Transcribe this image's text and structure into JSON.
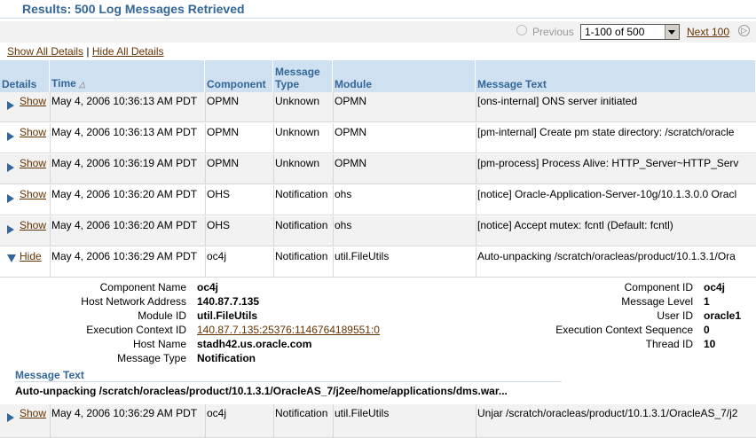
{
  "page": {
    "title": "Results: 500 Log Messages Retrieved"
  },
  "nav": {
    "previous": "Previous",
    "range": "1-100 of 500",
    "next": "Next 100"
  },
  "details_links": {
    "show_all": "Show All Details",
    "hide_all": "Hide All Details",
    "separator": "|"
  },
  "table": {
    "headers": {
      "details": "Details",
      "time": "Time",
      "component": "Component",
      "message_type_1": "Message",
      "message_type_2": "Type",
      "module": "Module",
      "message_text": "Message Text"
    },
    "rows": [
      {
        "action": "Show",
        "time": "May 4, 2006 10:36:13 AM PDT",
        "component": "OPMN",
        "type": "Unknown",
        "module": "OPMN",
        "text": "[ons-internal] ONS server initiated"
      },
      {
        "action": "Show",
        "time": "May 4, 2006 10:36:13 AM PDT",
        "component": "OPMN",
        "type": "Unknown",
        "module": "OPMN",
        "text": "[pm-internal] Create pm state directory: /scratch/oracle"
      },
      {
        "action": "Show",
        "time": "May 4, 2006 10:36:19 AM PDT",
        "component": "OPMN",
        "type": "Unknown",
        "module": "OPMN",
        "text": "[pm-process] Process Alive: HTTP_Server~HTTP_Serv"
      },
      {
        "action": "Show",
        "time": "May 4, 2006 10:36:20 AM PDT",
        "component": "OHS",
        "type": "Notification",
        "module": "ohs",
        "text": "[notice] Oracle-Application-Server-10g/10.1.3.0.0 Oracl"
      },
      {
        "action": "Show",
        "time": "May 4, 2006 10:36:20 AM PDT",
        "component": "OHS",
        "type": "Notification",
        "module": "ohs",
        "text": "[notice] Accept mutex: fcntl (Default: fcntl)"
      },
      {
        "action": "Hide",
        "time": "May 4, 2006 10:36:29 AM PDT",
        "component": "oc4j",
        "type": "Notification",
        "module": "util.FileUtils",
        "text": "Auto-unpacking /scratch/oracleas/product/10.1.3.1/Ora"
      },
      {
        "action": "Show",
        "time": "May 4, 2006 10:36:29 AM PDT",
        "component": "oc4j",
        "type": "Notification",
        "module": "util.FileUtils",
        "text": "Unjar /scratch/oracleas/product/10.1.3.1/OracleAS_7/j2"
      }
    ]
  },
  "detail": {
    "component_name_label": "Component Name",
    "component_name": "oc4j",
    "host_network_address_label": "Host Network Address",
    "host_network_address": "140.87.7.135",
    "module_id_label": "Module ID",
    "module_id": "util.FileUtils",
    "execution_context_id_label": "Execution Context ID",
    "execution_context_id": "140.87.7.135:25376:1146764189551:0",
    "host_name_label": "Host Name",
    "host_name": "stadh42.us.oracle.com",
    "message_type_label": "Message Type",
    "message_type": "Notification",
    "component_id_label": "Component ID",
    "component_id": "oc4j",
    "message_level_label": "Message Level",
    "message_level": "1",
    "user_id_label": "User ID",
    "user_id": "oracle1",
    "execution_context_sequence_label": "Execution Context Sequence",
    "execution_context_sequence": "0",
    "thread_id_label": "Thread ID",
    "thread_id": "10",
    "message_text_label": "Message Text",
    "message_text": "Auto-unpacking /scratch/oracleas/product/10.1.3.1/OracleAS_7/j2ee/home/applications/dms.war..."
  },
  "colors": {
    "header_bg": "#cfe0f1",
    "header_text": "#336699",
    "link": "#663300",
    "row_alt": "#f2f2f2"
  }
}
